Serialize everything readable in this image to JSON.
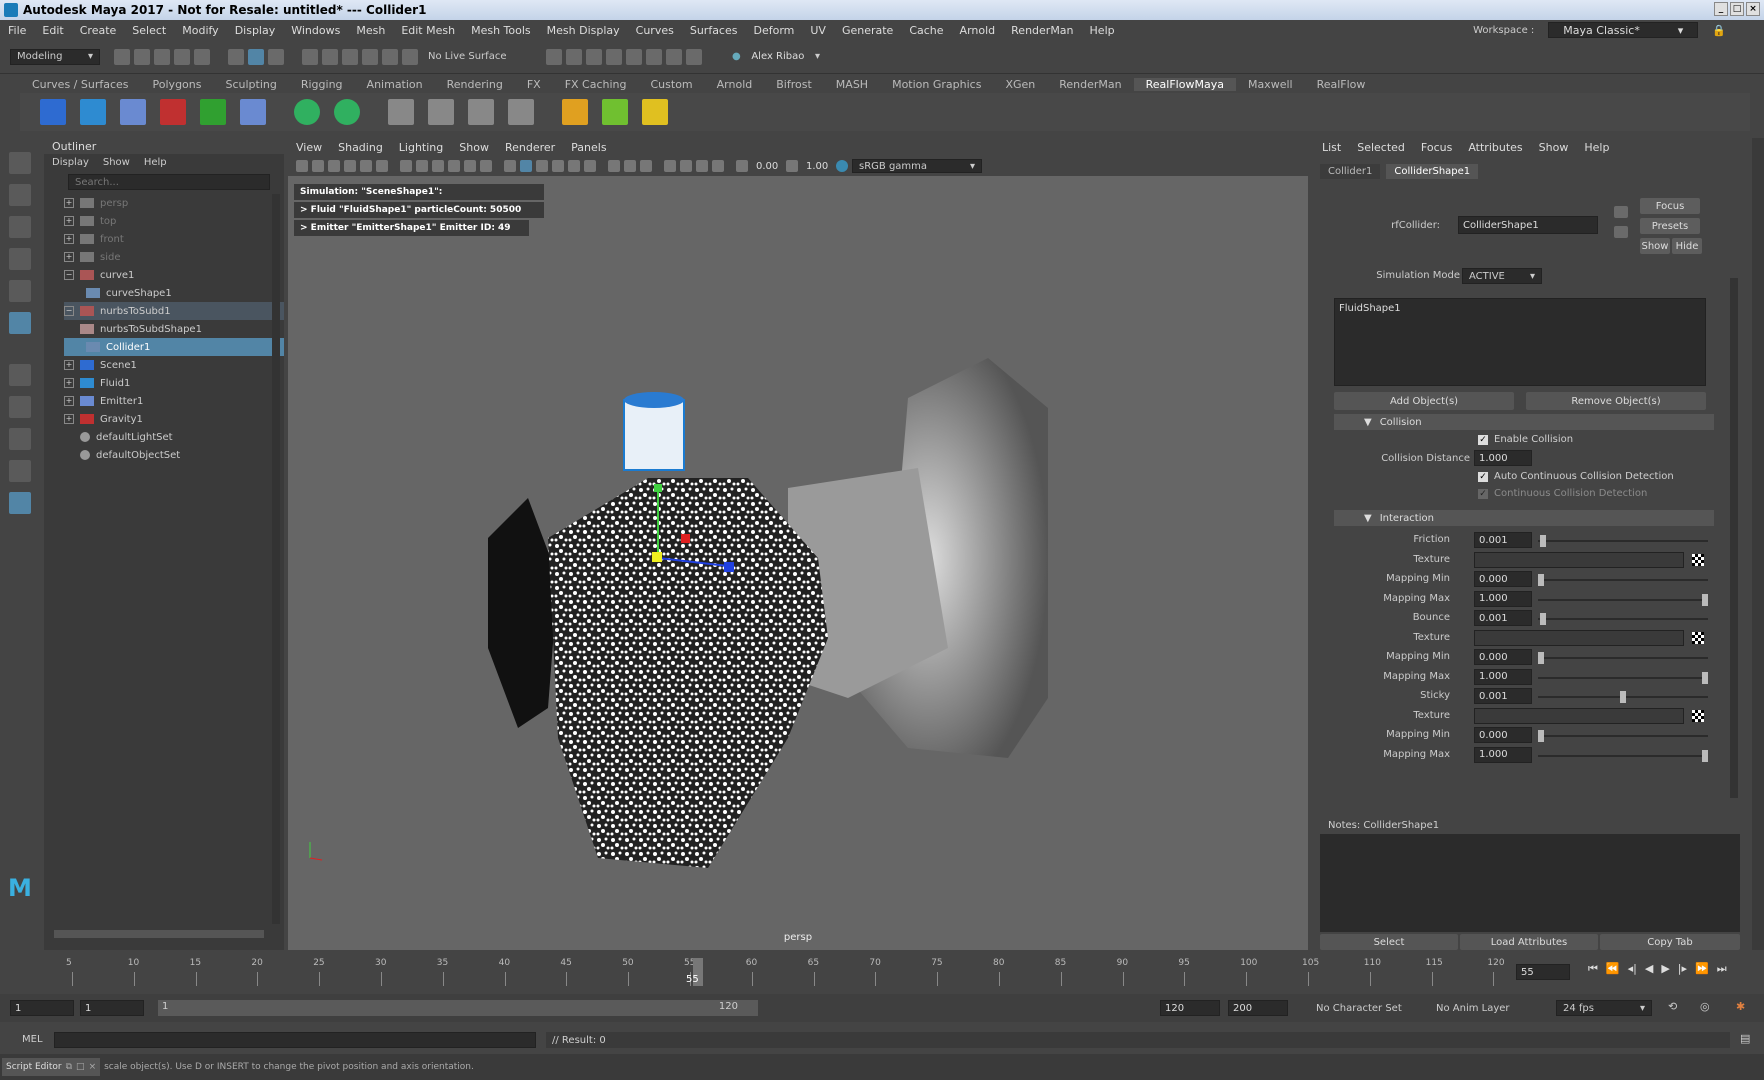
{
  "window": {
    "title": "Autodesk Maya 2017 - Not for Resale: untitled*   ---   Collider1"
  },
  "menu": [
    "File",
    "Edit",
    "Create",
    "Select",
    "Modify",
    "Display",
    "Windows",
    "Mesh",
    "Edit Mesh",
    "Mesh Tools",
    "Mesh Display",
    "Curves",
    "Surfaces",
    "Deform",
    "UV",
    "Generate",
    "Cache",
    "Arnold",
    "RenderMan",
    "Help"
  ],
  "workspace": {
    "label": "Workspace :",
    "value": "Maya Classic*"
  },
  "status": {
    "mode": "Modeling",
    "live_surface": "No Live Surface",
    "user": "Alex Ribao"
  },
  "shelf_tabs": [
    "Curves / Surfaces",
    "Polygons",
    "Sculpting",
    "Rigging",
    "Animation",
    "Rendering",
    "FX",
    "FX Caching",
    "Custom",
    "Arnold",
    "Bifrost",
    "MASH",
    "Motion Graphics",
    "XGen",
    "RenderMan",
    "RealFlowMaya",
    "Maxwell",
    "RealFlow"
  ],
  "shelf_active": "RealFlowMaya",
  "outliner": {
    "title": "Outliner",
    "menu": [
      "Display",
      "Show",
      "Help"
    ],
    "search_placeholder": "Search...",
    "items": [
      {
        "label": "persp"
      },
      {
        "label": "top"
      },
      {
        "label": "front"
      },
      {
        "label": "side"
      },
      {
        "label": "curve1"
      },
      {
        "label": "curveShape1"
      },
      {
        "label": "nurbsToSubd1"
      },
      {
        "label": "nurbsToSubdShape1"
      },
      {
        "label": "Collider1"
      },
      {
        "label": "Scene1"
      },
      {
        "label": "Fluid1"
      },
      {
        "label": "Emitter1"
      },
      {
        "label": "Gravity1"
      },
      {
        "label": "defaultLightSet"
      },
      {
        "label": "defaultObjectSet"
      }
    ]
  },
  "viewport": {
    "menu": [
      "View",
      "Shading",
      "Lighting",
      "Show",
      "Renderer",
      "Panels"
    ],
    "near_value": "0.00",
    "gamma_value": "1.00",
    "color_space": "sRGB gamma",
    "hud": [
      "Simulation: \"SceneShape1\":",
      "> Fluid \"FluidShape1\" particleCount: 50500",
      "> Emitter \"EmitterShape1\" Emitter ID: 49"
    ],
    "camera": "persp"
  },
  "attr_editor": {
    "menu": [
      "List",
      "Selected",
      "Focus",
      "Attributes",
      "Show",
      "Help"
    ],
    "tabs": [
      "Collider1",
      "ColliderShape1"
    ],
    "node_label": "rfCollider:",
    "node_value": "ColliderShape1",
    "focus": "Focus",
    "presets": "Presets",
    "show": "Show",
    "hide": "Hide",
    "sim_mode_label": "Simulation Mode",
    "sim_mode_value": "ACTIVE",
    "linked_item": "FluidShape1",
    "add_objects": "Add Object(s)",
    "remove_objects": "Remove Object(s)",
    "collision": {
      "title": "Collision",
      "enable": "Enable Collision",
      "distance_label": "Collision Distance",
      "distance_value": "1.000",
      "auto_ccd": "Auto Continuous Collision Detection",
      "ccd": "Continuous Collision Detection"
    },
    "interaction": {
      "title": "Interaction",
      "rows": [
        {
          "label": "Friction",
          "value": "0.001",
          "level": 0.01
        },
        {
          "label": "Texture"
        },
        {
          "label": "Mapping Min",
          "value": "0.000",
          "level": 0
        },
        {
          "label": "Mapping Max",
          "value": "1.000",
          "level": 1
        },
        {
          "label": "Bounce",
          "value": "0.001",
          "level": 0.01
        },
        {
          "label": "Texture"
        },
        {
          "label": "Mapping Min",
          "value": "0.000",
          "level": 0
        },
        {
          "label": "Mapping Max",
          "value": "1.000",
          "level": 1
        },
        {
          "label": "Sticky",
          "value": "0.001",
          "level": 0.5
        },
        {
          "label": "Texture"
        },
        {
          "label": "Mapping Min",
          "value": "0.000",
          "level": 0
        },
        {
          "label": "Mapping Max",
          "value": "1.000",
          "level": 1
        }
      ]
    },
    "notes_label": "Notes:  ColliderShape1",
    "select": "Select",
    "load_attributes": "Load Attributes",
    "copy_tab": "Copy Tab"
  },
  "timeline": {
    "ticks": [
      "5",
      "10",
      "15",
      "20",
      "25",
      "30",
      "35",
      "40",
      "45",
      "50",
      "55",
      "60",
      "65",
      "70",
      "75",
      "80",
      "85",
      "90",
      "95",
      "100",
      "105",
      "110",
      "115",
      "120"
    ],
    "current_frame": "55",
    "frame_field": "55"
  },
  "range": {
    "start": "1",
    "start2": "1",
    "slider_start": "1",
    "slider_end": "120",
    "end": "120",
    "end2": "200",
    "char_set": "No Character Set",
    "anim_layer": "No Anim Layer",
    "fps": "24 fps"
  },
  "cmd": {
    "lang": "MEL",
    "result": "// Result: 0"
  },
  "help": {
    "script_editor": "Script Editor",
    "message": "scale object(s). Use D or INSERT to change the pivot position and axis orientation."
  }
}
